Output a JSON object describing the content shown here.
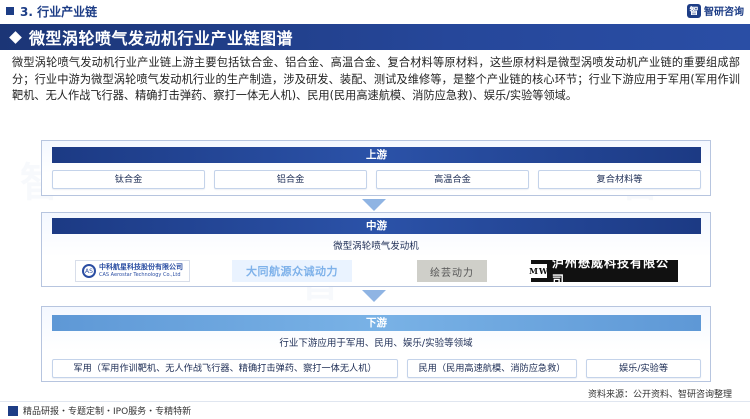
{
  "header": {
    "section": "3. 行业产业链",
    "brand": "智研咨询",
    "brand_logo": "智"
  },
  "title": "微型涡轮喷气发动机行业产业链图谱",
  "description": "微型涡轮喷气发动机行业产业链上游主要包括钛合金、铝合金、高温合金、复合材料等原材料，这些原材料是微型涡喷发动机产业链的重要组成部分；行业中游为微型涡轮喷气发动机行业的生产制造，涉及研发、装配、测试及维修等，是整个产业链的核心环节；行业下游应用于军用(军用作训靶机、无人作战飞行器、精确打击弹药、察打一体无人机)、民用(民用高速航模、消防应急救)、娱乐/实验等领域。",
  "upstream": {
    "title": "上游",
    "items": [
      "钛合金",
      "铝合金",
      "高温合金",
      "复合材料等"
    ]
  },
  "midstream": {
    "title": "中游",
    "subtitle": "微型涡轮喷气发动机",
    "logos": [
      {
        "name": "中科航星科技股份有限公司",
        "en": "CAS Aerostar Technology Co.,Ltd",
        "mark": "AS"
      },
      {
        "name": "大同航源众诚动力"
      },
      {
        "name": "绘芸动力"
      },
      {
        "name": "泸州懋威科技有限公司",
        "mark": "MW"
      }
    ]
  },
  "downstream": {
    "title": "下游",
    "subtitle": "行业下游应用于军用、民用、娱乐/实验等领域",
    "items": [
      "军用（军用作训靶机、无人作战飞行器、精确打击弹药、察打一体无人机）",
      "民用（民用高速航模、消防应急救）",
      "娱乐/实验等"
    ]
  },
  "footer": {
    "left": "精品研报・专题定制・IPO服务・专精特新",
    "source": "资料来源：公开资料、智研咨询整理"
  },
  "colors": {
    "primary": "#1d3d86",
    "band_light": "#79b2e6"
  }
}
